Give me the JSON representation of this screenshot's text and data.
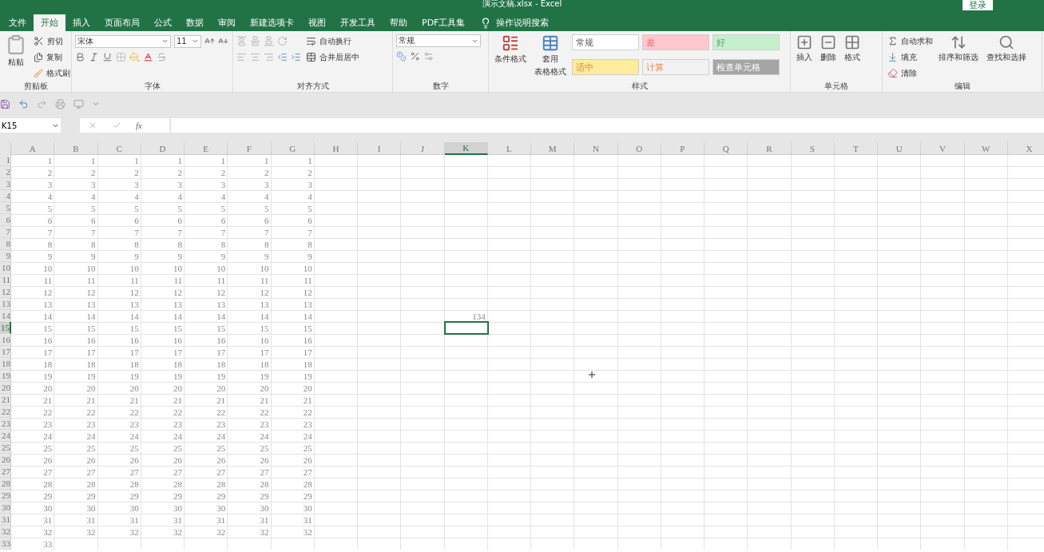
{
  "window": {
    "title": "演示文稿.xlsx - Excel",
    "login": "登录"
  },
  "tabs": [
    {
      "label": "文件",
      "selected": false
    },
    {
      "label": "开始",
      "selected": true
    },
    {
      "label": "插入",
      "selected": false
    },
    {
      "label": "页面布局",
      "selected": false
    },
    {
      "label": "公式",
      "selected": false
    },
    {
      "label": "数据",
      "selected": false
    },
    {
      "label": "审阅",
      "selected": false
    },
    {
      "label": "新建选项卡",
      "selected": false
    },
    {
      "label": "视图",
      "selected": false
    },
    {
      "label": "开发工具",
      "selected": false
    },
    {
      "label": "帮助",
      "selected": false
    },
    {
      "label": "PDF工具集",
      "selected": false
    }
  ],
  "tell_me": "操作说明搜索",
  "ribbon": {
    "clipboard": {
      "label": "剪贴板",
      "paste": "粘贴",
      "cut": "剪切",
      "copy": "复制",
      "format_painter": "格式刷"
    },
    "font": {
      "label": "字体",
      "font_name": "宋体",
      "font_size": "11"
    },
    "alignment": {
      "label": "对齐方式",
      "wrap": "自动换行",
      "merge": "合并后居中"
    },
    "number": {
      "label": "数字",
      "format": "常规"
    },
    "styles": {
      "label": "样式",
      "conditional": "条件格式",
      "table_format": [
        "套用",
        "表格格式"
      ],
      "cell_styles": [
        {
          "label": "常规",
          "color": "#ffffff",
          "kind": "normal"
        },
        {
          "label": "差",
          "color": "#ffc7ce",
          "kind": "bad"
        },
        {
          "label": "好",
          "color": "#c6efce",
          "kind": "good"
        },
        {
          "label": "适中",
          "color": "#ffeb9c",
          "kind": "neutral"
        },
        {
          "label": "计算",
          "color": "#f2f2f2",
          "kind": "calculation"
        },
        {
          "label": "检查单元格",
          "color": "#a5a5a5",
          "kind": "check"
        }
      ]
    },
    "cells": {
      "label": "单元格",
      "insert": "插入",
      "delete": "删除",
      "format": "格式"
    },
    "editing": {
      "label": "编辑",
      "autosum": "自动求和",
      "fill": "填充",
      "clear": "清除",
      "sort": "排序和筛选",
      "find": "查找和选择"
    }
  },
  "formula_bar": {
    "name_box": "K15",
    "function_label": "fx"
  },
  "sheet": {
    "columns": [
      {
        "label": "A",
        "selected": false
      },
      {
        "label": "B",
        "selected": false
      },
      {
        "label": "C",
        "selected": false
      },
      {
        "label": "D",
        "selected": false
      },
      {
        "label": "E",
        "selected": false
      },
      {
        "label": "F",
        "selected": false
      },
      {
        "label": "G",
        "selected": false
      },
      {
        "label": "H",
        "selected": false
      },
      {
        "label": "I",
        "selected": false
      },
      {
        "label": "J",
        "selected": false
      },
      {
        "label": "K",
        "selected": true
      },
      {
        "label": "L",
        "selected": false
      },
      {
        "label": "M",
        "selected": false
      },
      {
        "label": "N",
        "selected": false
      },
      {
        "label": "O",
        "selected": false
      },
      {
        "label": "P",
        "selected": false
      },
      {
        "label": "Q",
        "selected": false
      },
      {
        "label": "R",
        "selected": false
      },
      {
        "label": "S",
        "selected": false
      },
      {
        "label": "T",
        "selected": false
      },
      {
        "label": "U",
        "selected": false
      },
      {
        "label": "V",
        "selected": false
      },
      {
        "label": "W",
        "selected": false
      },
      {
        "label": "X",
        "selected": false
      }
    ],
    "rows": [
      {
        "header": "1",
        "selected": false,
        "cells": [
          "1",
          "1",
          "1",
          "1",
          "1",
          "1",
          "1"
        ]
      },
      {
        "header": "2",
        "selected": false,
        "cells": [
          "2",
          "2",
          "2",
          "2",
          "2",
          "2",
          "2"
        ]
      },
      {
        "header": "3",
        "selected": false,
        "cells": [
          "3",
          "3",
          "3",
          "3",
          "3",
          "3",
          "3"
        ]
      },
      {
        "header": "4",
        "selected": false,
        "cells": [
          "4",
          "4",
          "4",
          "4",
          "4",
          "4",
          "4"
        ]
      },
      {
        "header": "5",
        "selected": false,
        "cells": [
          "5",
          "5",
          "5",
          "5",
          "5",
          "5",
          "5"
        ]
      },
      {
        "header": "6",
        "selected": false,
        "cells": [
          "6",
          "6",
          "6",
          "6",
          "6",
          "6",
          "6"
        ]
      },
      {
        "header": "7",
        "selected": false,
        "cells": [
          "7",
          "7",
          "7",
          "7",
          "7",
          "7",
          "7"
        ]
      },
      {
        "header": "8",
        "selected": false,
        "cells": [
          "8",
          "8",
          "8",
          "8",
          "8",
          "8",
          "8"
        ]
      },
      {
        "header": "9",
        "selected": false,
        "cells": [
          "9",
          "9",
          "9",
          "9",
          "9",
          "9",
          "9"
        ]
      },
      {
        "header": "10",
        "selected": false,
        "cells": [
          "10",
          "10",
          "10",
          "10",
          "10",
          "10",
          "10"
        ]
      },
      {
        "header": "11",
        "selected": false,
        "cells": [
          "11",
          "11",
          "11",
          "11",
          "11",
          "11",
          "11"
        ]
      },
      {
        "header": "12",
        "selected": false,
        "cells": [
          "12",
          "12",
          "12",
          "12",
          "12",
          "12",
          "12"
        ]
      },
      {
        "header": "13",
        "selected": false,
        "cells": [
          "13",
          "13",
          "13",
          "13",
          "13",
          "13",
          "13"
        ]
      },
      {
        "header": "14",
        "selected": false,
        "cells": [
          "14",
          "14",
          "14",
          "14",
          "14",
          "14",
          "14",
          null,
          null,
          null,
          "134"
        ]
      },
      {
        "header": "15",
        "selected": true,
        "cells": [
          "15",
          "15",
          "15",
          "15",
          "15",
          "15",
          "15"
        ]
      },
      {
        "header": "16",
        "selected": false,
        "cells": [
          "16",
          "16",
          "16",
          "16",
          "16",
          "16",
          "16"
        ]
      },
      {
        "header": "17",
        "selected": false,
        "cells": [
          "17",
          "17",
          "17",
          "17",
          "17",
          "17",
          "17"
        ]
      },
      {
        "header": "18",
        "selected": false,
        "cells": [
          "18",
          "18",
          "18",
          "18",
          "18",
          "18",
          "18"
        ]
      },
      {
        "header": "19",
        "selected": false,
        "cells": [
          "19",
          "19",
          "19",
          "19",
          "19",
          "19",
          "19"
        ]
      },
      {
        "header": "20",
        "selected": false,
        "cells": [
          "20",
          "20",
          "20",
          "20",
          "20",
          "20",
          "20"
        ]
      },
      {
        "header": "21",
        "selected": false,
        "cells": [
          "21",
          "21",
          "21",
          "21",
          "21",
          "21",
          "21"
        ]
      },
      {
        "header": "22",
        "selected": false,
        "cells": [
          "22",
          "22",
          "22",
          "22",
          "22",
          "22",
          "22"
        ]
      },
      {
        "header": "23",
        "selected": false,
        "cells": [
          "23",
          "23",
          "23",
          "23",
          "23",
          "23",
          "23"
        ]
      },
      {
        "header": "24",
        "selected": false,
        "cells": [
          "24",
          "24",
          "24",
          "24",
          "24",
          "24",
          "24"
        ]
      },
      {
        "header": "25",
        "selected": false,
        "cells": [
          "25",
          "25",
          "25",
          "25",
          "25",
          "25",
          "25"
        ]
      },
      {
        "header": "26",
        "selected": false,
        "cells": [
          "26",
          "26",
          "26",
          "26",
          "26",
          "26",
          "26"
        ]
      },
      {
        "header": "27",
        "selected": false,
        "cells": [
          "27",
          "27",
          "27",
          "27",
          "27",
          "27",
          "27"
        ]
      },
      {
        "header": "28",
        "selected": false,
        "cells": [
          "28",
          "28",
          "28",
          "28",
          "28",
          "28",
          "28"
        ]
      },
      {
        "header": "29",
        "selected": false,
        "cells": [
          "29",
          "29",
          "29",
          "29",
          "29",
          "29",
          "29"
        ]
      },
      {
        "header": "30",
        "selected": false,
        "cells": [
          "30",
          "30",
          "30",
          "30",
          "30",
          "30",
          "30"
        ]
      },
      {
        "header": "31",
        "selected": false,
        "cells": [
          "31",
          "31",
          "31",
          "31",
          "31",
          "31",
          "31"
        ]
      },
      {
        "header": "32",
        "selected": false,
        "cells": [
          "32",
          "32",
          "32",
          "32",
          "32",
          "32",
          "32"
        ]
      },
      {
        "header": "33",
        "selected": false,
        "cells": [
          "33"
        ]
      }
    ]
  }
}
